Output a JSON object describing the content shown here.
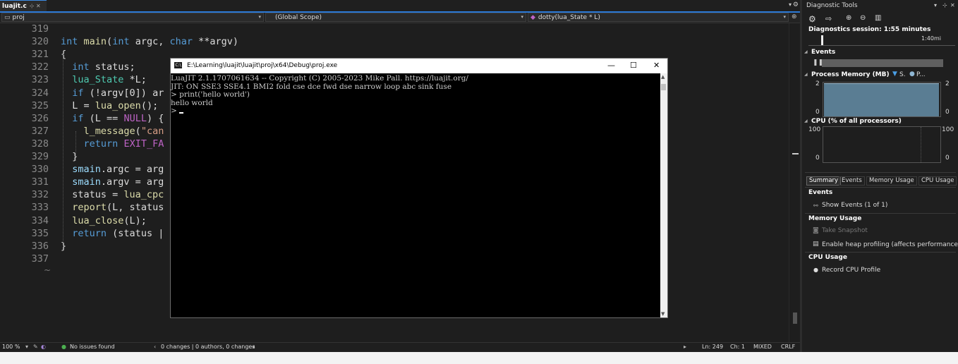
{
  "editor": {
    "tab_label": "luajit.c",
    "tab_pin": "⊹ ✕",
    "nav": {
      "project": "proj",
      "scope": "(Global Scope)",
      "function": "dotty(lua_State * L)"
    },
    "line_numbers": [
      "319",
      "320",
      "321",
      "322",
      "323",
      "324",
      "325",
      "326",
      "327",
      "328",
      "329",
      "330",
      "331",
      "332",
      "333",
      "334",
      "335",
      "336",
      "337"
    ],
    "end_marker": "~",
    "code_lines": [
      "",
      "int main(int argc, char **argv)",
      "{",
      "  int status;",
      "  lua_State *L;",
      "  if (!argv[0]) ar",
      "  L = lua_open();",
      "  if (L == NULL) {",
      "    l_message(\"can",
      "    return EXIT_FA",
      "  }",
      "  smain.argc = arg",
      "  smain.argv = arg",
      "  status = lua_cpc",
      "  report(L, status",
      "  lua_close(L);",
      "  return (status |",
      "}",
      ""
    ]
  },
  "status_bar": {
    "zoom": "100 %",
    "issues": "No issues found",
    "changes": "0 changes | 0 authors, 0 changes",
    "line": "Ln: 249",
    "col": "Ch: 1",
    "mode": "MIXED",
    "eol": "CRLF"
  },
  "console": {
    "title": "E:\\Learning\\luajit\\luajit\\proj\\x64\\Debug\\proj.exe",
    "icon_text": "C:\\",
    "lines": [
      "LuaJIT 2.1.1707061634 -- Copyright (C) 2005-2023 Mike Pall. https://luajit.org/",
      "JIT: ON SSE3 SSE4.1 BMI2 fold cse dce fwd dse narrow loop abc sink fuse",
      "> print('hello world')",
      "hello world",
      ">"
    ],
    "minimize": "—",
    "maximize": "☐",
    "close": "✕"
  },
  "diagnostics": {
    "title": "Diagnostic Tools",
    "session": "Diagnostics session: 1:55 minutes",
    "timeline_label": "1:40mi",
    "events_label": "Events",
    "process_memory_label": "Process Memory (MB)",
    "legend_s": "S.",
    "legend_p": "P...",
    "mem_max": "2",
    "mem_min": "0",
    "memory_level": 0.95,
    "cpu_label": "CPU (% of all processors)",
    "cpu_max": "100",
    "cpu_min": "0",
    "tabs": [
      "Summary",
      "Events",
      "Memory Usage",
      "CPU Usage"
    ],
    "summary": {
      "events_header": "Events",
      "show_events": "Show Events (1 of 1)",
      "memory_header": "Memory Usage",
      "take_snapshot": "Take Snapshot",
      "heap_profiling": "Enable heap profiling (affects performance)",
      "cpu_header": "CPU Usage",
      "record_cpu": "Record CPU Profile"
    },
    "colors": {
      "accent": "#2b79d7",
      "memory_fill": "#5a7d93"
    }
  }
}
